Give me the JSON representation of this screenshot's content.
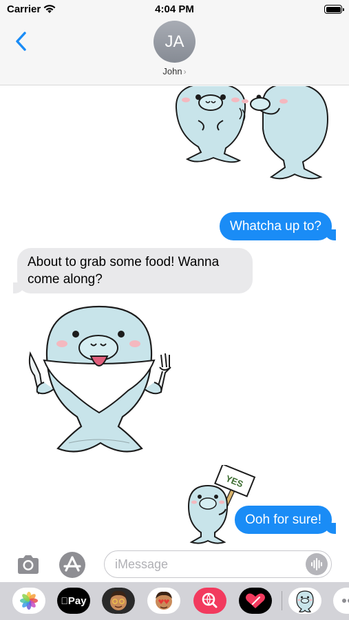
{
  "status_bar": {
    "carrier": "Carrier",
    "time": "4:04 PM"
  },
  "header": {
    "avatar_initials": "JA",
    "contact_name": "John",
    "chevron": "›"
  },
  "messages": [
    {
      "type": "sticker",
      "direction": "outgoing",
      "sticker": "two-manatees-sticker"
    },
    {
      "type": "text",
      "direction": "outgoing",
      "text": "Whatcha up to?"
    },
    {
      "type": "text",
      "direction": "incoming",
      "text": "About to grab some food! Wanna come along?"
    },
    {
      "type": "sticker",
      "direction": "incoming",
      "sticker": "manatee-bib-fork-knife-sticker"
    },
    {
      "type": "sticker",
      "direction": "outgoing",
      "sticker": "manatee-yes-sign-sticker",
      "sign_text": "YES"
    },
    {
      "type": "text",
      "direction": "outgoing",
      "text": "Ooh for sure!"
    }
  ],
  "input": {
    "placeholder": "iMessage"
  },
  "app_drawer": {
    "apps": [
      {
        "name": "photos-app-icon"
      },
      {
        "name": "apple-pay-app-icon",
        "label": "Pay"
      },
      {
        "name": "memoji-app-icon"
      },
      {
        "name": "memoji-stickers-app-icon"
      },
      {
        "name": "search-images-app-icon"
      },
      {
        "name": "digital-touch-app-icon"
      },
      {
        "name": "manatee-stickers-app-icon"
      },
      {
        "name": "more-apps-icon"
      }
    ]
  },
  "colors": {
    "outgoing": "#1a8cf6",
    "incoming": "#e9e9eb",
    "accent": "#1a8cf6",
    "manatee": "#c8e4ea"
  }
}
